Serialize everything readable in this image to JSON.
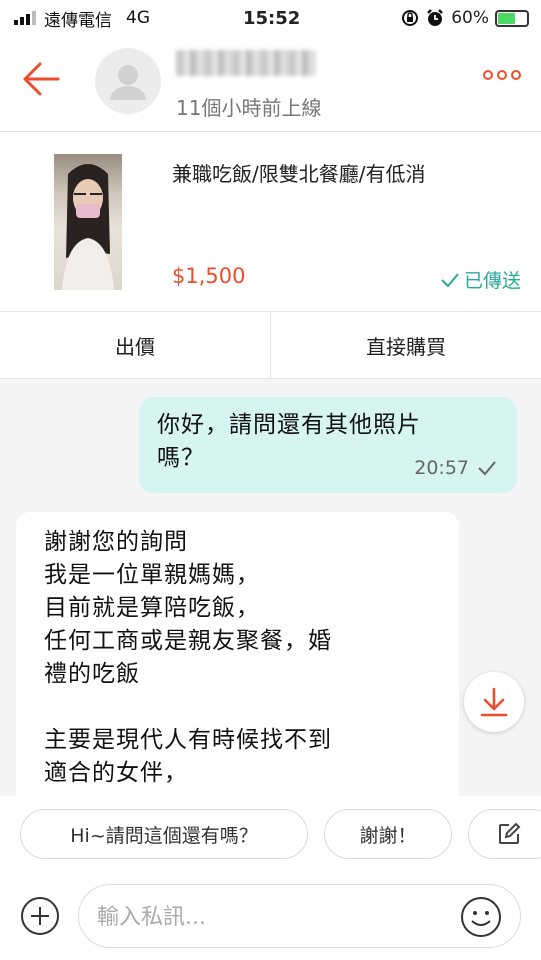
{
  "status_bar": {
    "carrier": "遠傳電信",
    "network": "4G",
    "time": "15:52",
    "battery": "60%",
    "battery_level": 0.6
  },
  "header": {
    "last_seen": "11個小時前上線"
  },
  "product": {
    "title": "兼職吃飯/限雙北餐廳/有低消",
    "price": "$1,500",
    "status": "已傳送",
    "offer_label": "出價",
    "buy_label": "直接購買"
  },
  "messages": {
    "outgoing": {
      "lines": [
        "你好，請問還有其他照片",
        "嗎？"
      ],
      "time": "20:57"
    },
    "incoming": {
      "lines": [
        "謝謝您的詢問",
        "我是一位單親媽媽，",
        "目前就是算陪吃飯，",
        "任何工商或是親友聚餐，婚",
        "禮的吃飯",
        "",
        "主要是現代人有時候找不到",
        "適合的女伴，"
      ]
    }
  },
  "quick_replies": [
    "Hi~請問這個還有嗎？",
    "謝謝！"
  ],
  "input": {
    "placeholder": "輸入私訊..."
  },
  "colors": {
    "accent": "#ee4d2d",
    "sent_green": "#26aa99",
    "outgoing_bubble": "#d6f5f0"
  },
  "icons": [
    "back-arrow-icon",
    "more-icon",
    "check-icon",
    "scroll-down-icon",
    "edit-icon",
    "plus-icon",
    "emoji-icon"
  ]
}
